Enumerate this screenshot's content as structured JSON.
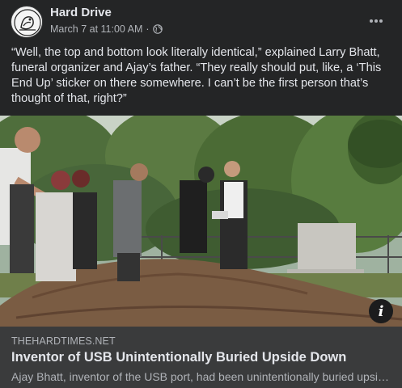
{
  "post": {
    "page_name": "Hard Drive",
    "timestamp": "March 7 at 11:00 AM",
    "separator": "·",
    "audience_icon": "globe-icon",
    "more_icon": "more-options-icon",
    "caption": "“Well, the top and bottom look literally identical,” explained Larry Bhatt, funeral organizer and Ajay’s father. “They really should put, like, a ‘This End Up’ sticker on there somewhere. I can’t be the first person that’s thought of that, right?”"
  },
  "link_preview": {
    "domain": "THEHARDTIMES.NET",
    "title": "Inventor of USB Unintentionally Buried Upside Down",
    "description": "Ajay Bhatt, inventor of the USB port, had been unintentionally buried upside down",
    "info_icon": "info-icon"
  },
  "colors": {
    "background": "#242526",
    "link_background": "#3a3b3c",
    "primary_text": "#e4e6eb",
    "secondary_text": "#b0b3b8"
  }
}
